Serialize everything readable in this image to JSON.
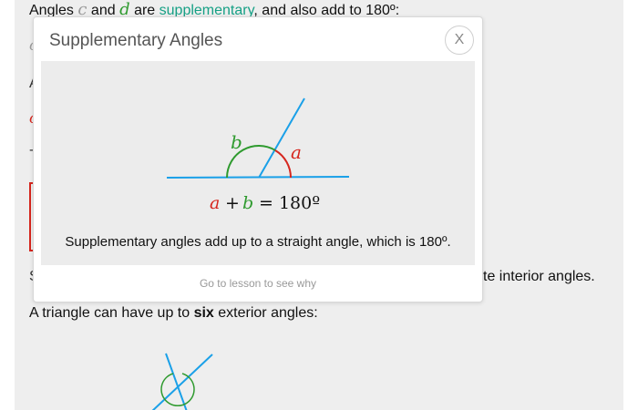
{
  "intro": {
    "prefix": "Angles",
    "var_c": "c",
    "and_word": "and",
    "var_d": "d",
    "are_word": "are",
    "link": "supplementary",
    "suffix": ", and also add to 180º:"
  },
  "background": {
    "fragment_c": "c",
    "fragment_a": "A",
    "fragment_red": "c",
    "fragment_dash": "-",
    "fragment_s": "S",
    "interior_text": "te interior angles."
  },
  "triangle_line": {
    "prefix": "A triangle can have up to",
    "emphasis": "six",
    "suffix": "exterior angles:"
  },
  "modal": {
    "title": "Supplementary Angles",
    "close_label": "X",
    "caption": "Supplementary angles add up to a straight angle, which is 180º.",
    "footer_link": "Go to lesson to see why",
    "diagram": {
      "label_b": "b",
      "label_a": "a",
      "eq_a": "a",
      "eq_plus": "+",
      "eq_b": "b",
      "eq_rest": "= 180º"
    }
  },
  "colors": {
    "green": "#2e9a2e",
    "red": "#d6261e",
    "blue": "#1aa0e8",
    "teal_link": "#16a085"
  }
}
